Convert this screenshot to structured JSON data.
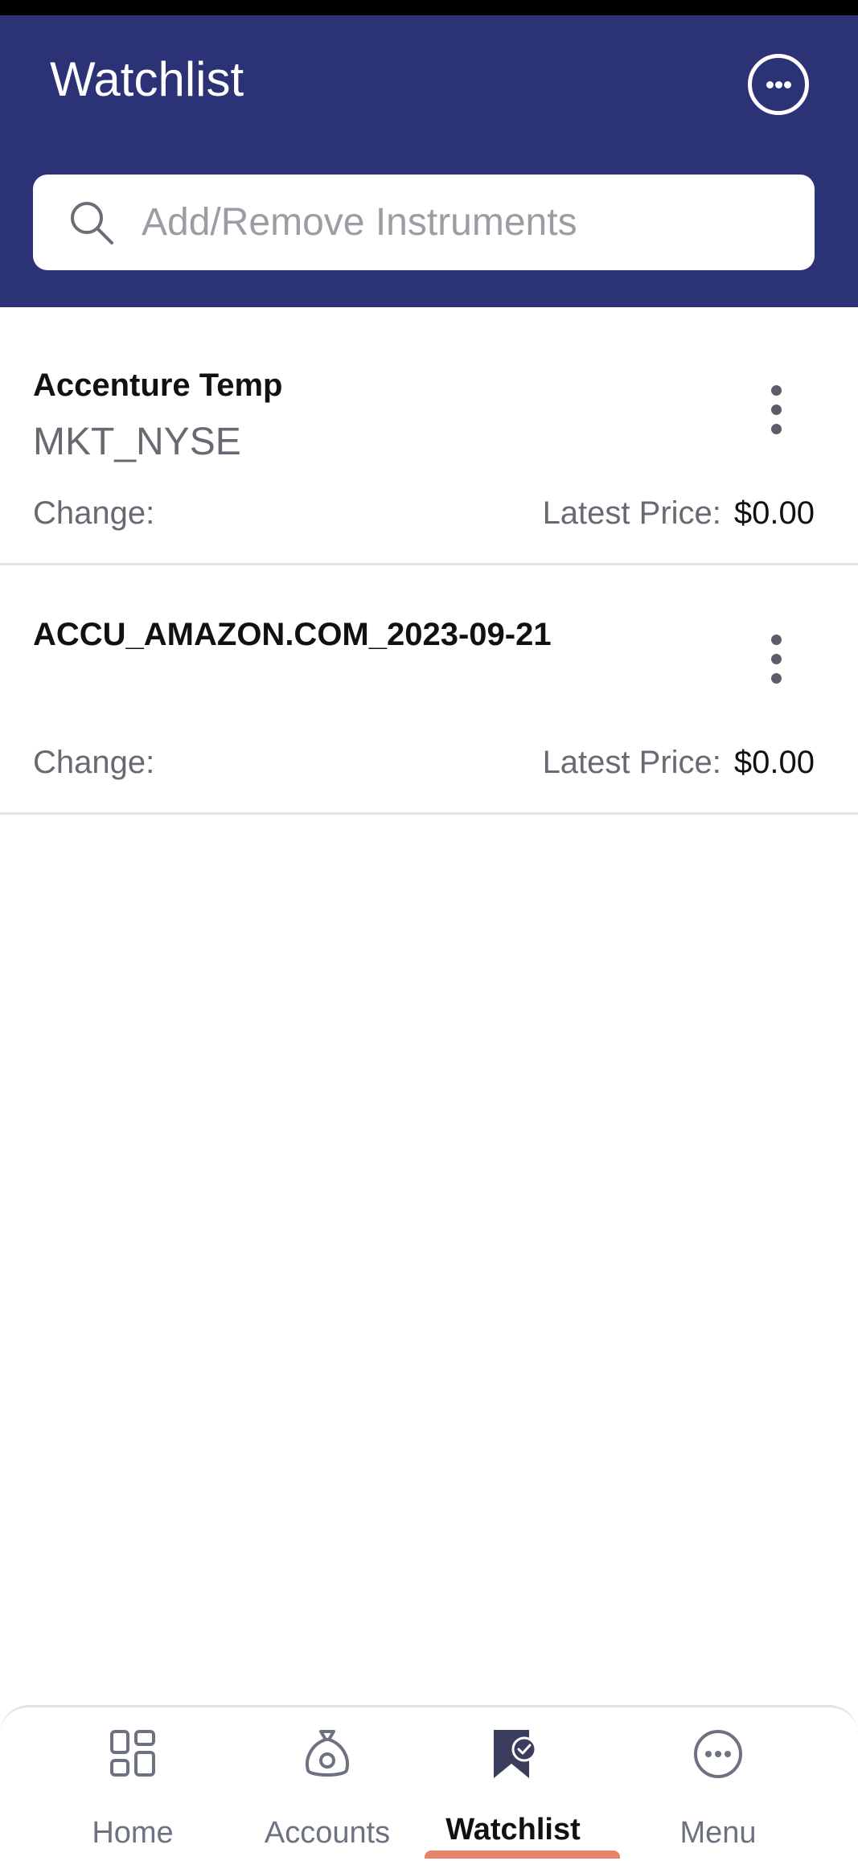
{
  "header": {
    "title": "Watchlist",
    "more_icon": "more-horizontal-circle-icon",
    "background_color": "#2b3276"
  },
  "search": {
    "placeholder": "Add/Remove Instruments",
    "value": "",
    "icon": "search-icon"
  },
  "watchlist": {
    "items": [
      {
        "name": "Accenture Temp",
        "market": "MKT_NYSE",
        "change_label": "Change:",
        "change_value": "",
        "latest_price_label": "Latest Price:",
        "latest_price_value": "$0.00"
      },
      {
        "name": "ACCU_AMAZON.COM_2023-09-21",
        "market": "",
        "change_label": "Change:",
        "change_value": "",
        "latest_price_label": "Latest Price:",
        "latest_price_value": "$0.00"
      }
    ]
  },
  "bottom_nav": {
    "items": [
      {
        "label": "Home",
        "icon": "home-grid-icon",
        "active": false
      },
      {
        "label": "Accounts",
        "icon": "money-bag-icon",
        "active": false
      },
      {
        "label": "Watchlist",
        "icon": "bookmark-check-icon",
        "active": true
      },
      {
        "label": "Menu",
        "icon": "more-horizontal-circle-icon",
        "active": false
      }
    ],
    "active_indicator_color": "#e8836a"
  }
}
